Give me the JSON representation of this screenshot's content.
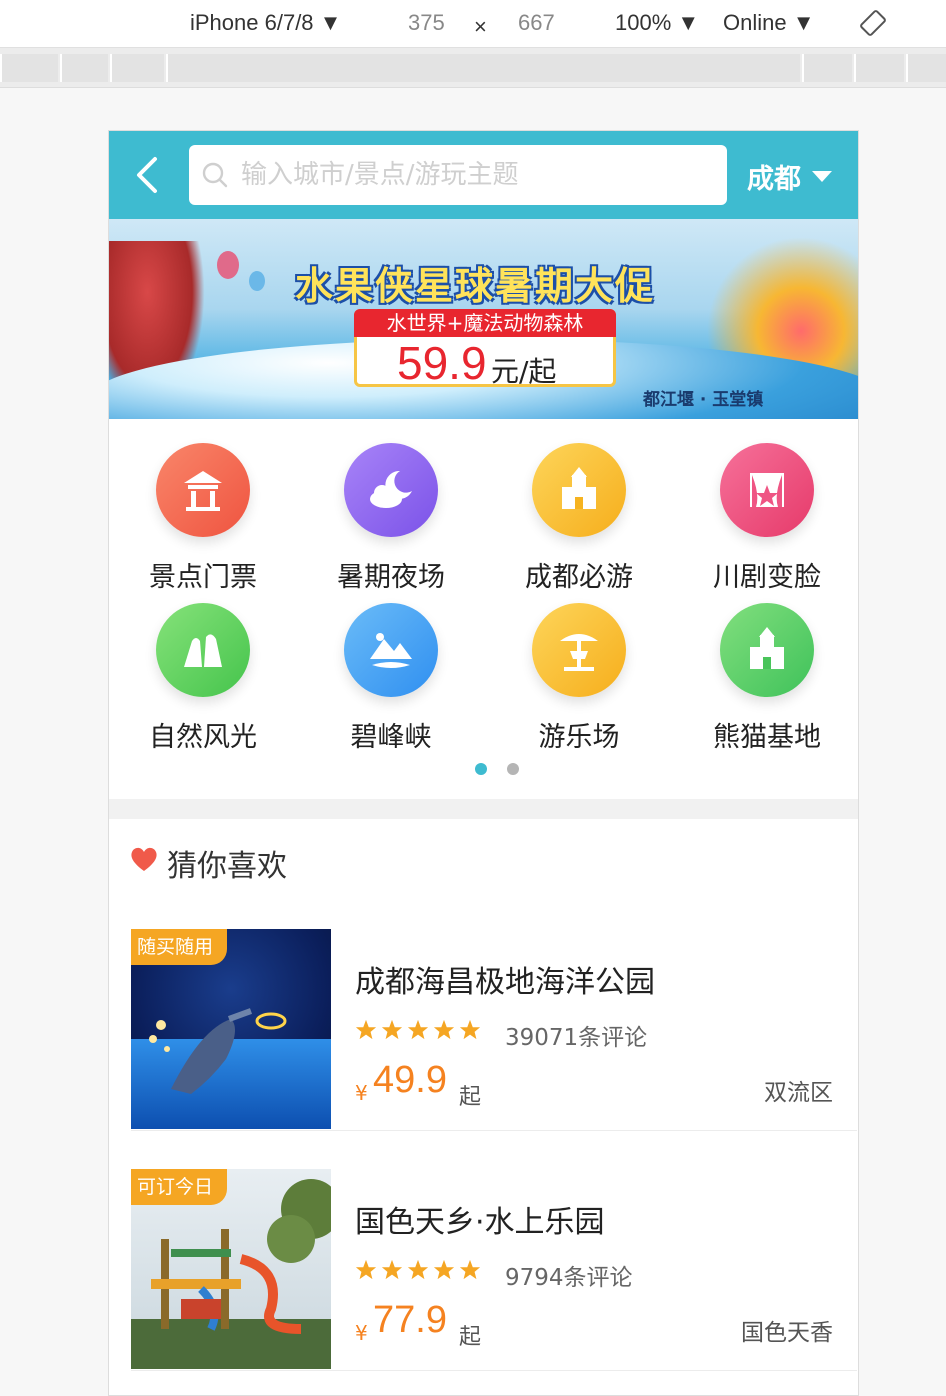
{
  "devtools": {
    "device": "iPhone 6/7/8",
    "width": "375",
    "times": "×",
    "height": "667",
    "zoom": "100%",
    "network": "Online"
  },
  "header": {
    "search_placeholder": "输入城市/景点/游玩主题",
    "city": "成都"
  },
  "banner": {
    "headline": "水果侠星球暑期大促",
    "subtitle": "水世界+魔法动物森林",
    "price": "59.9",
    "unit": "元/起",
    "place": "都江堰 · 玉堂镇"
  },
  "categories": [
    {
      "label": "景点门票",
      "icon": "pavilion-icon",
      "color": "#f2644a"
    },
    {
      "label": "暑期夜场",
      "icon": "moon-cloud-icon",
      "color": "#8b63ef"
    },
    {
      "label": "成都必游",
      "icon": "castle-icon",
      "color": "#f8c02c"
    },
    {
      "label": "川剧变脸",
      "icon": "theater-curtain-icon",
      "color": "#ef4f7c"
    },
    {
      "label": "自然风光",
      "icon": "waterfall-icon",
      "color": "#63d45a"
    },
    {
      "label": "碧峰峡",
      "icon": "mountain-icon",
      "color": "#40a2f2"
    },
    {
      "label": "游乐场",
      "icon": "carousel-icon",
      "color": "#f8c02c"
    },
    {
      "label": "熊猫基地",
      "icon": "castle-icon",
      "color": "#5dcf65"
    }
  ],
  "pager": {
    "active_color": "#3ebbd0",
    "inactive_color": "#b5b5b5"
  },
  "like": {
    "title": "猜你喜欢",
    "items": [
      {
        "tag": "随买随用",
        "title": "成都海昌极地海洋公园",
        "reviews": "39071条评论",
        "yen": "¥",
        "price": "49.9",
        "suffix": "起",
        "area": "双流区"
      },
      {
        "tag": "可订今日",
        "title": "国色天乡·水上乐园",
        "reviews": "9794条评论",
        "yen": "¥",
        "price": "77.9",
        "suffix": "起",
        "area": "国色天香"
      }
    ]
  },
  "colors": {
    "header": "#3ebbd0",
    "accent": "#f58220",
    "tag": "#f5a623",
    "heart": "#f05a4a"
  }
}
